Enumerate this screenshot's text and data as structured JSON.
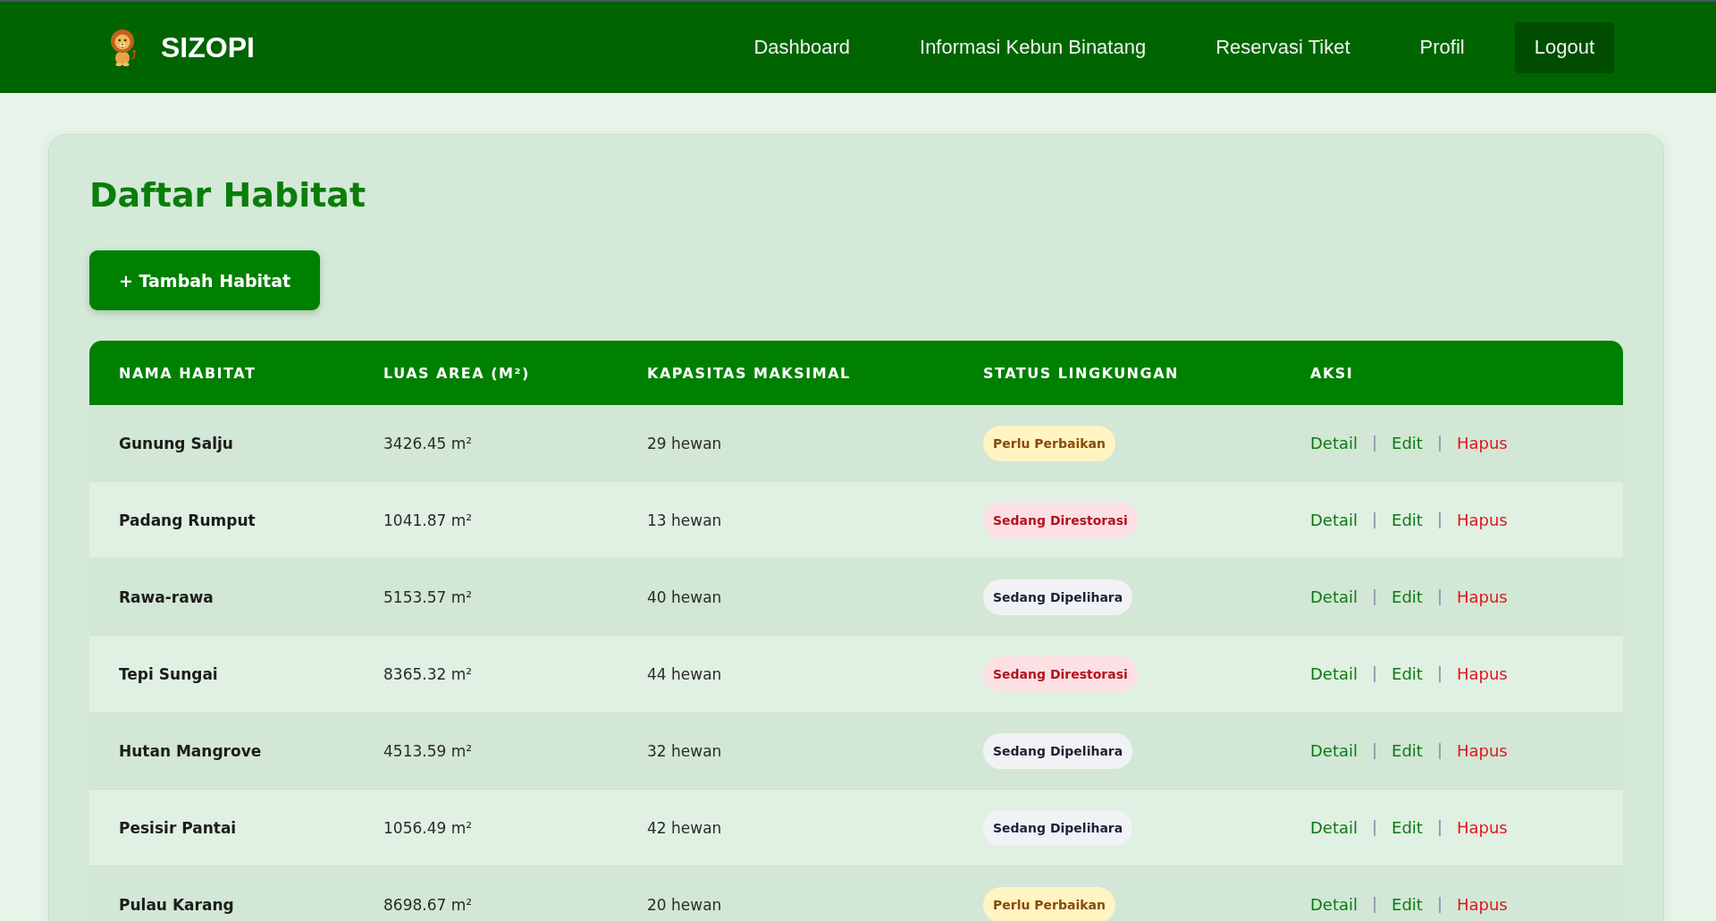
{
  "header": {
    "brand": "SIZOPI",
    "nav": [
      {
        "label": "Dashboard",
        "kind": "link"
      },
      {
        "label": "Informasi Kebun Binatang",
        "kind": "link"
      },
      {
        "label": "Reservasi Tiket",
        "kind": "link"
      },
      {
        "label": "Profil",
        "kind": "link"
      },
      {
        "label": "Logout",
        "kind": "button"
      }
    ]
  },
  "page": {
    "title": "Daftar Habitat",
    "add_button": "+ Tambah Habitat"
  },
  "table": {
    "columns": [
      "NAMA HABITAT",
      "LUAS AREA (M²)",
      "KAPASITAS MAKSIMAL",
      "STATUS LINGKUNGAN",
      "AKSI"
    ],
    "rows": [
      {
        "name": "Gunung Salju",
        "area": "3426.45 m²",
        "capacity": "29 hewan",
        "status": {
          "label": "Perlu Perbaikan",
          "kind": "warning"
        },
        "actions": [
          {
            "label": "Detail",
            "kind": "view"
          },
          {
            "label": "Edit",
            "kind": "edit"
          },
          {
            "label": "Hapus",
            "kind": "delete"
          }
        ]
      },
      {
        "name": "Padang Rumput",
        "area": "1041.87 m²",
        "capacity": "13 hewan",
        "status": {
          "label": "Sedang Direstorasi",
          "kind": "danger"
        },
        "actions": [
          {
            "label": "Detail",
            "kind": "view"
          },
          {
            "label": "Edit",
            "kind": "edit"
          },
          {
            "label": "Hapus",
            "kind": "delete"
          }
        ]
      },
      {
        "name": "Rawa-rawa",
        "area": "5153.57 m²",
        "capacity": "40 hewan",
        "status": {
          "label": "Sedang Dipelihara",
          "kind": "neutral"
        },
        "actions": [
          {
            "label": "Detail",
            "kind": "view"
          },
          {
            "label": "Edit",
            "kind": "edit"
          },
          {
            "label": "Hapus",
            "kind": "delete"
          }
        ]
      },
      {
        "name": "Tepi Sungai",
        "area": "8365.32 m²",
        "capacity": "44 hewan",
        "status": {
          "label": "Sedang Direstorasi",
          "kind": "danger"
        },
        "actions": [
          {
            "label": "Detail",
            "kind": "view"
          },
          {
            "label": "Edit",
            "kind": "edit"
          },
          {
            "label": "Hapus",
            "kind": "delete"
          }
        ]
      },
      {
        "name": "Hutan Mangrove",
        "area": "4513.59 m²",
        "capacity": "32 hewan",
        "status": {
          "label": "Sedang Dipelihara",
          "kind": "neutral"
        },
        "actions": [
          {
            "label": "Detail",
            "kind": "view"
          },
          {
            "label": "Edit",
            "kind": "edit"
          },
          {
            "label": "Hapus",
            "kind": "delete"
          }
        ]
      },
      {
        "name": "Pesisir Pantai",
        "area": "1056.49 m²",
        "capacity": "42 hewan",
        "status": {
          "label": "Sedang Dipelihara",
          "kind": "neutral"
        },
        "actions": [
          {
            "label": "Detail",
            "kind": "view"
          },
          {
            "label": "Edit",
            "kind": "edit"
          },
          {
            "label": "Hapus",
            "kind": "delete"
          }
        ]
      },
      {
        "name": "Pulau Karang",
        "area": "8698.67 m²",
        "capacity": "20 hewan",
        "status": {
          "label": "Perlu Perbaikan",
          "kind": "warning"
        },
        "actions": [
          {
            "label": "Detail",
            "kind": "view"
          },
          {
            "label": "Edit",
            "kind": "edit"
          },
          {
            "label": "Hapus",
            "kind": "delete"
          }
        ]
      }
    ]
  }
}
